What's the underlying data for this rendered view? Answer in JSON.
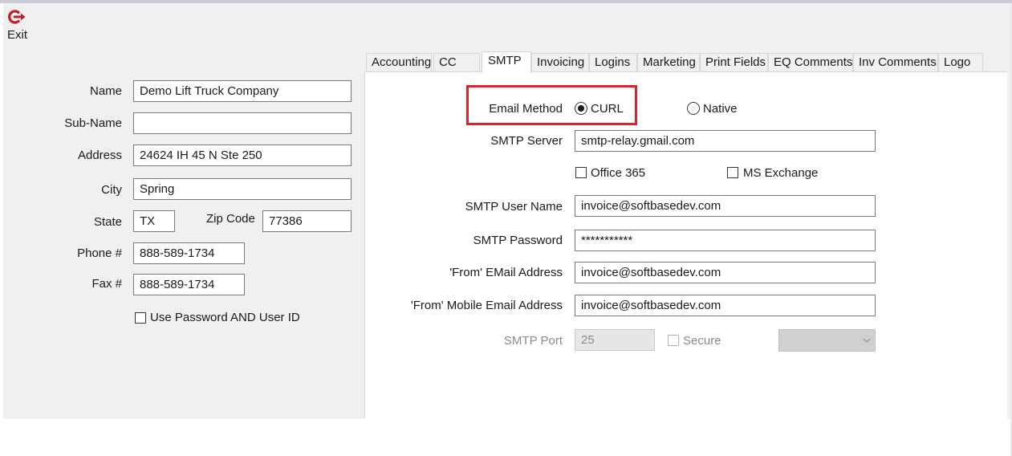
{
  "toolbar": {
    "exit_label": "Exit",
    "exit_icon": "exit-icon"
  },
  "company": {
    "name_label": "Name",
    "name_value": "Demo Lift Truck Company",
    "subname_label": "Sub-Name",
    "subname_value": "",
    "address_label": "Address",
    "address_value": "24624 IH 45 N Ste 250",
    "city_label": "City",
    "city_value": "Spring",
    "state_label": "State",
    "state_value": "TX",
    "zip_label": "Zip Code",
    "zip_value": "77386",
    "phone_label": "Phone #",
    "phone_value": "888-589-1734",
    "fax_label": "Fax #",
    "fax_value": "888-589-1734",
    "use_password_label": "Use Password AND User ID",
    "use_password_checked": false
  },
  "tabs": [
    {
      "label": "Accounting",
      "active": false
    },
    {
      "label": "CC",
      "active": false
    },
    {
      "label": "SMTP",
      "active": true
    },
    {
      "label": "Invoicing",
      "active": false
    },
    {
      "label": "Logins",
      "active": false
    },
    {
      "label": "Marketing",
      "active": false
    },
    {
      "label": "Print Fields",
      "active": false
    },
    {
      "label": "EQ Comments",
      "active": false
    },
    {
      "label": "Inv Comments",
      "active": false
    },
    {
      "label": "Logo",
      "active": false
    }
  ],
  "smtp": {
    "email_method_label": "Email Method",
    "curl_label": "CURL",
    "curl_selected": true,
    "native_label": "Native",
    "native_selected": false,
    "server_label": "SMTP Server",
    "server_value": "smtp-relay.gmail.com",
    "office365_label": "Office 365",
    "office365_checked": false,
    "msexchange_label": "MS Exchange",
    "msexchange_checked": false,
    "username_label": "SMTP User Name",
    "username_value": "invoice@softbasedev.com",
    "password_label": "SMTP Password",
    "password_value": "***********",
    "from_email_label": "'From' EMail Address",
    "from_email_value": "invoice@softbasedev.com",
    "from_mobile_label": "'From' Mobile Email Address",
    "from_mobile_value": "invoice@softbasedev.com",
    "port_label": "SMTP Port",
    "port_value": "25",
    "secure_label": "Secure",
    "secure_checked": false,
    "security_select_value": ""
  },
  "colors": {
    "highlight": "#e0202a",
    "exit_icon": "#c0202a"
  }
}
